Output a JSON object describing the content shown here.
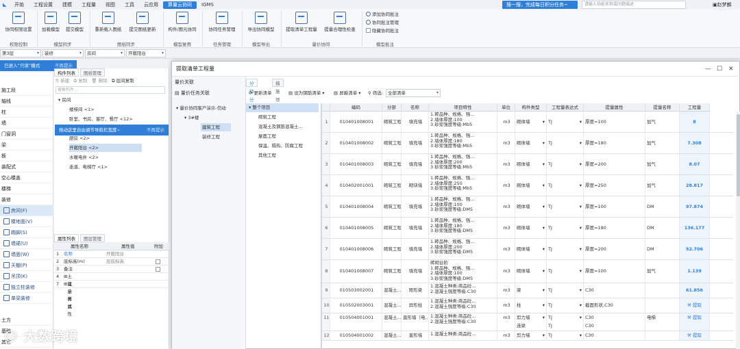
{
  "menu": {
    "items": [
      "开始",
      "工程设置",
      "建模",
      "工程量",
      "视图",
      "工具",
      "云应用",
      "算量云协同",
      "IGMS"
    ],
    "active_index": 7
  },
  "promo": {
    "label": "搜一搜，完成每日积分任务~"
  },
  "topsearch": {
    "placeholder": "请输入功能名称或问题描述"
  },
  "user": {
    "name": "赵梦麟"
  },
  "ribbon": {
    "buttons": [
      "协同权限设置",
      "加载模型",
      "提交模型",
      "重新载入图纸",
      "提交图纸更新",
      "构件/图元协同",
      "协同任务管理",
      "导出协同模型",
      "提取清单工程量",
      "提量合理性检查"
    ],
    "groups": [
      "权限控制",
      "模型同步",
      "图纸同步",
      "模型复用",
      "任务管理",
      "模型导出",
      "量价协同",
      "模型批注"
    ],
    "annot": [
      "添加协同批注",
      "协同批注管理",
      "隐藏协同批注"
    ]
  },
  "filters": {
    "floor": "第3层",
    "category": "装修",
    "type": "房间",
    "item": "开敞阳台"
  },
  "tip": {
    "entered": "已进入“只读”模式",
    "no_hint": "不再提示",
    "drag_tip": "拖动这里自由调节导航栏宽度~",
    "no_hint2": "不再提示"
  },
  "left": {
    "items": [
      "施工段",
      "轴线",
      "柱",
      "墙",
      "门窗洞",
      "梁",
      "板",
      "装配式",
      "空心楼盖",
      "楼梯",
      "装修"
    ],
    "sub": [
      "房间(F)",
      "楼地面(V)",
      "踢脚(S)",
      "墙裙(U)",
      "墙面(W)",
      "天棚(P)",
      "吊顶(K)",
      "独立柱装修",
      "单梁装修"
    ],
    "bottom": [
      "土方",
      "基础",
      "其它"
    ]
  },
  "mid": {
    "tabs": [
      "构件列表",
      "图纸管理"
    ],
    "toolbar": [
      "新建",
      "复制",
      "删除",
      "层间复制"
    ],
    "search_placeholder": "搜索构件...",
    "tree": [
      "房间",
      "楼梯间 <1>",
      "卧室、书房、客厅、餐厅 <12>",
      "厨房 <2>",
      "开敞阳台 <2>",
      "水暖电井 <2>",
      "走道、电梯厅 <1>"
    ],
    "prop_tabs": [
      "属性列表",
      "图层管理"
    ],
    "prop_head": [
      "属性名称",
      "属性值",
      "附加"
    ],
    "props": [
      {
        "n": "1",
        "name": "名称",
        "val": "开敞阳台"
      },
      {
        "n": "2",
        "name": "底标高(m)",
        "val": "层底标高"
      },
      {
        "n": "3",
        "name": "备注",
        "val": ""
      },
      {
        "n": "4",
        "name": "土建业务属性",
        "val": ""
      },
      {
        "n": "7",
        "name": "显示样式",
        "val": ""
      }
    ]
  },
  "dialog": {
    "title": "提取清单工程量",
    "nav_title": "量价关联",
    "nav_item": "量价任务关联",
    "nav_tree": [
      "量价协同客户演示-勿动",
      "3#楼",
      "建筑工程",
      "装修工程"
    ],
    "tabs": [
      "分部分项",
      "措施项目"
    ],
    "toolbar": [
      "更新清单",
      "设为钢筋清单",
      "屏蔽清单",
      "筛选:"
    ],
    "filter_value": "全部清单",
    "cats": [
      "整个项目",
      "砌筑工程",
      "混凝土及钢筋混凝土...",
      "屋面工程",
      "保温、隔热、防腐工程",
      "其他工程"
    ],
    "columns": [
      "编码",
      "分部",
      "名称",
      "项目特性",
      "单位",
      "构件类型",
      "工程量表达式",
      "提量属性",
      "提量名称",
      "工程量"
    ],
    "rows": [
      {
        "n": "1",
        "code": "010401008001",
        "part": "砌筑工程",
        "name": "填充墙",
        "feat": [
          "1.砖品种、规格、强...",
          "2.墙体厚度:100",
          "3.砂浆强度等级:Mb5"
        ],
        "unit": "m3",
        "type": "砌体墙",
        "expr": "TJ",
        "attr": "厚度=100",
        "pname": "加气",
        "qty": "8"
      },
      {
        "n": "2",
        "code": "010401008002",
        "part": "砌筑工程",
        "name": "填充墙",
        "feat": [
          "1.砖品种、规格、强...",
          "2.墙体厚度:180",
          "3.砂浆强度等级:Mb5"
        ],
        "unit": "m3",
        "type": "砌体墙",
        "expr": "TJ",
        "attr": "厚度=180",
        "pname": "加气",
        "qty": "7.308"
      },
      {
        "n": "3",
        "code": "010401008003",
        "part": "砌筑工程",
        "name": "填充墙",
        "feat": [
          "1.砖品种、规格、强...",
          "2.墙体厚度:200",
          "3.砂浆强度等级:Mb5"
        ],
        "unit": "m3",
        "type": "砌体墙",
        "expr": "TJ",
        "attr": "厚度=200",
        "pname": "加气",
        "qty": "8.07"
      },
      {
        "n": "4",
        "code": "010402001001",
        "part": "砌筑工程",
        "name": "砌块墙",
        "feat": [
          "1.砖品种、规格、强...",
          "2.墙体厚度:250",
          "3.砂浆强度等级:Mb5"
        ],
        "unit": "m3",
        "type": "砌体墙",
        "expr": "TJ",
        "attr": "厚度=250",
        "pname": "加气",
        "qty": "28.817"
      },
      {
        "n": "5",
        "code": "010401008004",
        "part": "砌筑工程",
        "name": "填充墙",
        "feat": [
          "1.砖品种、规格、强...",
          "2.墙体厚度:100",
          "3.砂浆强度等级:DM5"
        ],
        "unit": "m3",
        "type": "砌体墙",
        "expr": "TJ",
        "attr": "厚度=100",
        "pname": "DM",
        "qty": "97.874"
      },
      {
        "n": "6",
        "code": "010401008005",
        "part": "砌筑工程",
        "name": "填充墙",
        "feat": [
          "1.砖品种、规格、强...",
          "2.墙体厚度:180",
          "3.砂浆强度等级:DM5"
        ],
        "unit": "m3",
        "type": "砌体墙",
        "expr": "TJ",
        "attr": "厚度=180",
        "pname": "DM",
        "qty": "136.177"
      },
      {
        "n": "7",
        "code": "010401008006",
        "part": "砌筑工程",
        "name": "填充墙",
        "feat": [
          "1.砖品种、规格、强...",
          "2.墙体厚度:200",
          "3.砂浆强度等级:DM5"
        ],
        "unit": "m3",
        "type": "砌体墙",
        "expr": "TJ",
        "attr": "厚度=200",
        "pname": "DM",
        "qty": "52.706"
      },
      {
        "n": "8",
        "code": "010401008007",
        "part": "砌筑工程",
        "name": "填充墙",
        "feat": [
          "砖砌台阶",
          "1.砖品种、规格、强...",
          "2.墙体厚度:100",
          "3.砂浆强度等级:DM5"
        ],
        "unit": "m3",
        "type": "砌体墙",
        "expr": "TJ",
        "attr": "厚度=100",
        "pname": "加气",
        "qty": "1.139"
      },
      {
        "n": "9",
        "code": "010503002001",
        "part": "混凝土...",
        "name": "矩形梁",
        "feat": [
          "1.混凝土种类:商品砼...",
          "2.混凝土强度等级:C30"
        ],
        "unit": "m3",
        "type": "梁",
        "expr": "TJ",
        "attr": "C30",
        "pname": "",
        "qty": "61.856"
      },
      {
        "n": "10",
        "code": "010502003001",
        "part": "混凝土...",
        "name": "异形柱",
        "feat": [
          "1.混凝土种类:商品砼...",
          "2.混凝土强度等级:C30"
        ],
        "unit": "m3",
        "type": "柱",
        "expr": "TJ",
        "attr": "截面形状,C30",
        "pname": "",
        "qty": "提取"
      },
      {
        "n": "11",
        "code": "010504001001",
        "part": "混凝土...",
        "name": "直形墙（电...",
        "feat": [
          "1.混凝土种类:商品砼...",
          "2.混凝土强度等级:C30"
        ],
        "unit": "m3",
        "type": "剪力墙",
        "type2": "连梁",
        "expr": "TJ",
        "expr2": "TJ",
        "attr": "C30",
        "attr2": "C30",
        "pname": "电梯",
        "qty": "提取"
      },
      {
        "n": "12",
        "code": "010504001002",
        "part": "混凝土...",
        "name": "直形墙",
        "feat": [
          "1.混凝土种类:商品砼..."
        ],
        "unit": "m3",
        "type": "剪力墙",
        "expr": "TJ",
        "attr": "C30",
        "pname": "",
        "qty": "提取"
      }
    ]
  },
  "watermark": "大数跨境",
  "colors": {
    "accent": "#2f7fd8",
    "link": "#2f7fd8"
  }
}
